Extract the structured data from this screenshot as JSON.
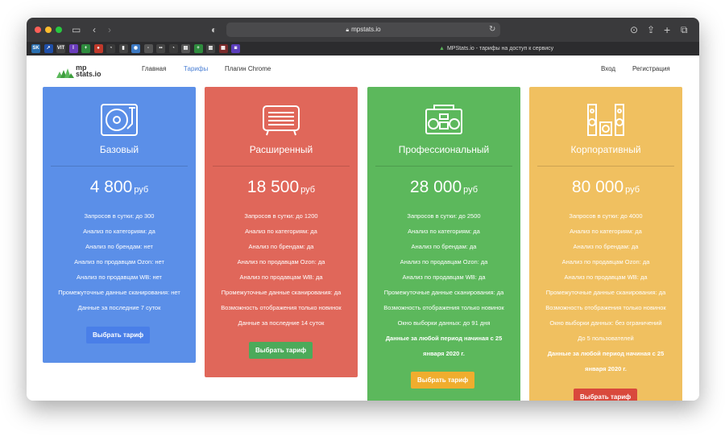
{
  "browser": {
    "url": "mpstats.io",
    "tab_title": "MPStats.io - тарифы на доступ к сервису",
    "favicons": [
      {
        "label": "SK",
        "color": "#2a6fb0"
      },
      {
        "label": "↗",
        "color": "#1f4fa8"
      },
      {
        "label": "VIT",
        "color": "#444444"
      },
      {
        "label": "ӏ",
        "color": "#6a3dbb"
      },
      {
        "label": "+",
        "color": "#2e8b3d"
      },
      {
        "label": "●",
        "color": "#c0392b"
      },
      {
        "label": "◔",
        "color": "#3a3a3a"
      },
      {
        "label": "▮",
        "color": "#444444"
      },
      {
        "label": "◉",
        "color": "#3b78c2"
      },
      {
        "label": "▫",
        "color": "#555555"
      },
      {
        "label": "••",
        "color": "#444444"
      },
      {
        "label": "◔",
        "color": "#3a3a3a"
      },
      {
        "label": "▤",
        "color": "#555555"
      },
      {
        "label": "+",
        "color": "#2e8b3d"
      },
      {
        "label": "▥",
        "color": "#444444"
      },
      {
        "label": "▦",
        "color": "#7a2a2a"
      },
      {
        "label": "◙",
        "color": "#5b3dbb"
      }
    ]
  },
  "site": {
    "logo_line1": "mp",
    "logo_line2": "stats.io",
    "nav": {
      "home": "Главная",
      "tariffs": "Тарифы",
      "plugin": "Плагин Chrome",
      "login": "Вход",
      "register": "Регистрация"
    }
  },
  "plans": [
    {
      "name": "Базовый",
      "price": "4 800",
      "currency": "руб",
      "color": "#5b8fe8",
      "icon": "turntable-icon",
      "features": [
        "Запросов в сутки: до 300",
        "Анализ по категориям: да",
        "Анализ по брендам: нет",
        "Анализ по продавцам Ozon: нет",
        "Анализ по продавцам WB: нет",
        "Промежуточные данные сканирования: нет",
        "Данные за последние 7 суток"
      ],
      "bold_note": "",
      "button": "Выбрать тариф",
      "button_color": "#4a7fe8"
    },
    {
      "name": "Расширенный",
      "price": "18 500",
      "currency": "руб",
      "color": "#e0675a",
      "icon": "radio-icon",
      "features": [
        "Запросов в сутки: до 1200",
        "Анализ по категориям: да",
        "Анализ по брендам: да",
        "Анализ по продавцам Ozon: да",
        "Анализ по продавцам WB: да",
        "Промежуточные данные сканирования: да",
        "Возможность отображения только новинок",
        "Данные за последние 14 суток"
      ],
      "bold_note": "",
      "button": "Выбрать тариф",
      "button_color": "#4caa5a"
    },
    {
      "name": "Профессиональный",
      "price": "28 000",
      "currency": "руб",
      "color": "#5cb85c",
      "icon": "boombox-icon",
      "features": [
        "Запросов в сутки: до 2500",
        "Анализ по категориям: да",
        "Анализ по брендам: да",
        "Анализ по продавцам Ozon: да",
        "Анализ по продавцам WB: да",
        "Промежуточные данные сканирования: да",
        "Возможность отображения только новинок",
        "Окно выборки данных: до 91 дня"
      ],
      "bold_note": "Данные за любой период начиная с 25 января 2020 г.",
      "button": "Выбрать тариф",
      "button_color": "#f0ad2e"
    },
    {
      "name": "Корпоративный",
      "price": "80 000",
      "currency": "руб",
      "color": "#f0c060",
      "icon": "speakers-icon",
      "features": [
        "Запросов в сутки: до 4000",
        "Анализ по категориям: да",
        "Анализ по брендам: да",
        "Анализ по продавцам Ozon: да",
        "Анализ по продавцам WB: да",
        "Промежуточные данные сканирования: да",
        "Возможность отображения только новинок",
        "Окно выборки данных: без ограничений",
        "До 5 пользователей"
      ],
      "bold_note": "Данные за любой период начиная с 25 января 2020 г.",
      "button": "Выбрать тариф",
      "button_color": "#d9493c"
    }
  ]
}
